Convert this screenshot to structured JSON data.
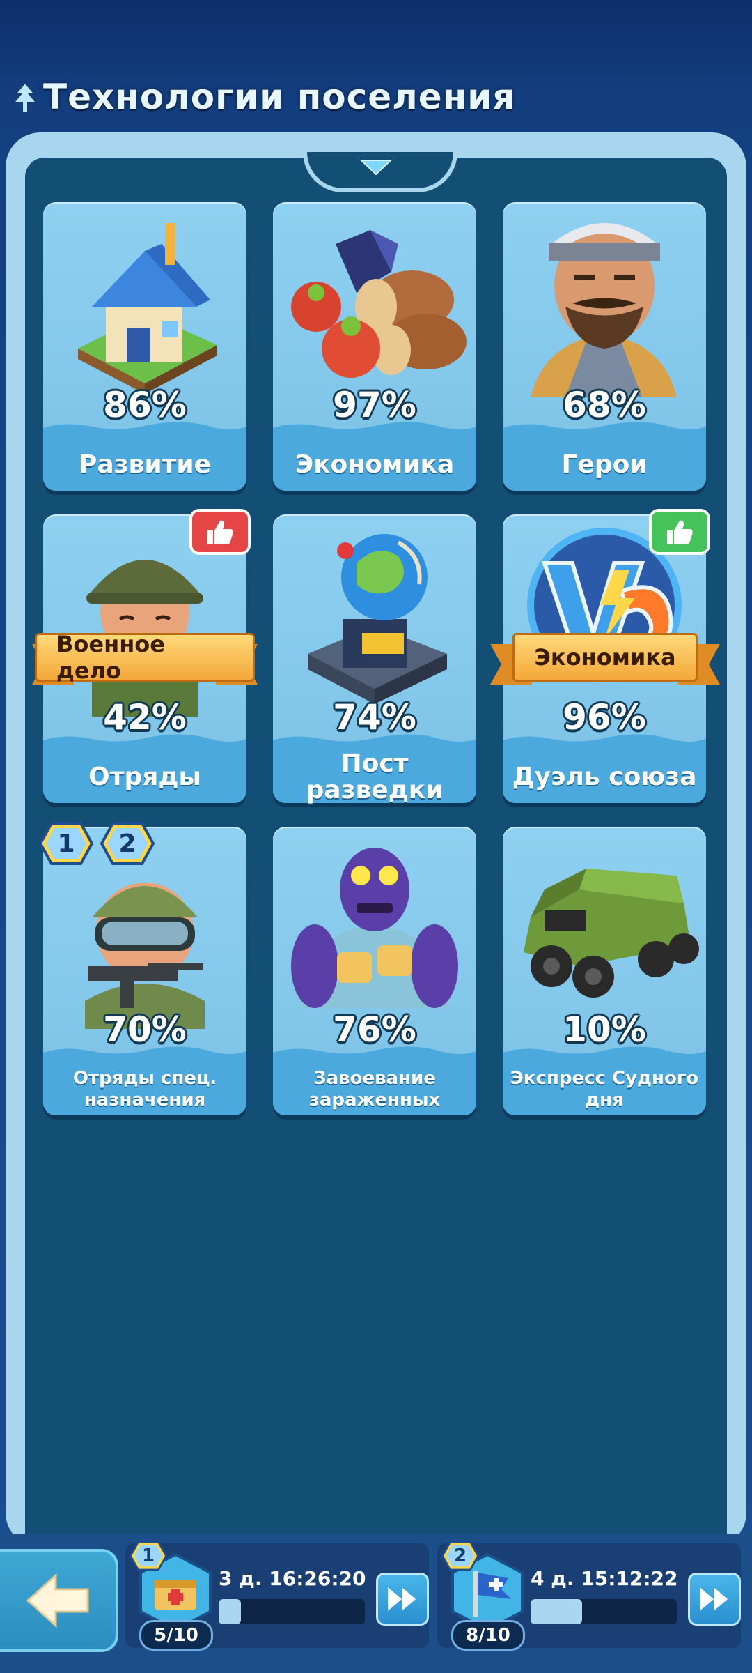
{
  "header": {
    "title": "Технологии поселения",
    "icon": "tree-icon"
  },
  "cards": [
    {
      "id": "development",
      "percent": "86%",
      "name": "Развитие",
      "icon": "house-icon",
      "progress": 0.86
    },
    {
      "id": "economy",
      "percent": "97%",
      "name": "Экономика",
      "icon": "resources-icon",
      "progress": 0.97
    },
    {
      "id": "heroes",
      "percent": "68%",
      "name": "Герои",
      "icon": "hero-icon",
      "progress": 0.68
    },
    {
      "id": "squads",
      "percent": "42%",
      "name": "Отряды",
      "icon": "soldier-icon",
      "progress": 0.42,
      "ribbon": "Военное дело",
      "thumb": "red"
    },
    {
      "id": "recon",
      "percent": "74%",
      "name": "Пост разведки",
      "icon": "globe-icon",
      "progress": 0.74
    },
    {
      "id": "alliance-duel",
      "percent": "96%",
      "name": "Дуэль союза",
      "icon": "versus-icon",
      "progress": 0.96,
      "ribbon": "Экономика",
      "thumb": "green"
    },
    {
      "id": "special-forces",
      "percent": "70%",
      "name": "Отряды спец. назначения",
      "icon": "special-soldier-icon",
      "progress": 0.7,
      "badges": [
        "1",
        "2"
      ]
    },
    {
      "id": "infected-conquest",
      "percent": "76%",
      "name": "Завоевание зараженных",
      "icon": "zombie-icon",
      "progress": 0.76
    },
    {
      "id": "doomsday-express",
      "percent": "10%",
      "name": "Экспресс Судного дня",
      "icon": "truck-icon",
      "progress": 0.1
    }
  ],
  "bottom": {
    "back_icon": "arrow-left-icon",
    "queues": [
      {
        "badge": "1",
        "timer": "3 д. 16:26:20",
        "count": "5/10",
        "icon": "research-chest-icon",
        "progress": 0.15,
        "action_icon": "fast-forward-icon"
      },
      {
        "badge": "2",
        "timer": "4 д. 15:12:22",
        "count": "8/10",
        "icon": "flag-icon",
        "progress": 0.35,
        "action_icon": "fast-forward-icon"
      }
    ]
  },
  "colors": {
    "panel_outer": "#a8d6ef",
    "panel_inner": "#134f74",
    "card": "#8fd0f1",
    "card_band": "#4ba9de",
    "ribbon": "#f4a83a",
    "thumb_red": "#e64545",
    "thumb_green": "#43c35a"
  }
}
